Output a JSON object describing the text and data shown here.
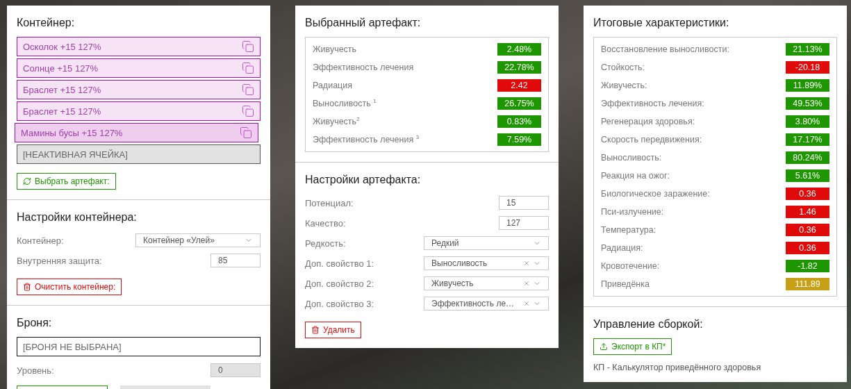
{
  "container": {
    "title": "Контейнер:",
    "slots": [
      {
        "kind": "artifact",
        "label": "Осколок +15 127%",
        "selected": false
      },
      {
        "kind": "artifact",
        "label": "Солнце +15 127%",
        "selected": false
      },
      {
        "kind": "artifact",
        "label": "Браслет +15 127%",
        "selected": false
      },
      {
        "kind": "artifact",
        "label": "Браслет +15 127%",
        "selected": false
      },
      {
        "kind": "artifact",
        "label": "Мамины бусы +15 127%",
        "selected": true
      },
      {
        "kind": "inactive",
        "label": "[НЕАКТИВНАЯ ЯЧЕЙКА]"
      }
    ],
    "button": "Выбрать артефакт:"
  },
  "container_settings": {
    "title": "Настройки контейнера:",
    "container_label": "Контейнер:",
    "container_value": "Контейнер «Улей»",
    "protection_label": "Внутренняя защита:",
    "protection_value": "85",
    "button": "Очистить контейнер:"
  },
  "armor": {
    "title": "Броня:",
    "value": "[БРОНЯ НЕ ВЫБРАНА]",
    "level_label": "Уровень:",
    "level_value": "0"
  },
  "selected_artifact": {
    "title": "Выбранный артефакт:",
    "stats": [
      {
        "label": "Живучесть",
        "value": "2.48%",
        "color": "#1e9600"
      },
      {
        "label": "Эффективность лечения",
        "value": "22.78%",
        "color": "#1e9600"
      },
      {
        "label": "Радиация",
        "value": "2.42",
        "color": "#e00a0a"
      },
      {
        "label": "Выносливость $^{1}$",
        "value": "26.75%",
        "color": "#1e9600"
      },
      {
        "label": "Живучесть$^{2}$",
        "value": "0.83%",
        "color": "#1e9600"
      },
      {
        "label": "Эффективность лечения $^{3}$",
        "value": "7.59%",
        "color": "#1e9600"
      }
    ]
  },
  "artifact_settings": {
    "title": "Настройки артефакта:",
    "fields": [
      {
        "kind": "input",
        "label": "Потенциал:",
        "value": "15"
      },
      {
        "kind": "input",
        "label": "Качество:",
        "value": "127"
      },
      {
        "kind": "select",
        "label": "Редкость:",
        "value": "Редкий",
        "clearable": false
      },
      {
        "kind": "select",
        "label": "Доп. свойство 1:",
        "value": "Выносливость",
        "clearable": true
      },
      {
        "kind": "select",
        "label": "Доп. свойство 2:",
        "value": "Живучесть",
        "clearable": true
      },
      {
        "kind": "select",
        "label": "Доп. свойство 3:",
        "value": "Эффективность ле…",
        "clearable": true
      }
    ],
    "button": "Удалить"
  },
  "totals": {
    "title": "Итоговые характеристики:",
    "stats": [
      {
        "label": "Восстановление выносливости:",
        "value": "21.13%",
        "color": "#1e9600"
      },
      {
        "label": "Стойкость:",
        "value": "-20.18",
        "color": "#e00a0a"
      },
      {
        "label": "Живучесть:",
        "value": "11.89%",
        "color": "#1e9600"
      },
      {
        "label": "Эффективность лечения:",
        "value": "49.53%",
        "color": "#1e9600"
      },
      {
        "label": "Регенерация здоровья:",
        "value": "3.80%",
        "color": "#1e9600"
      },
      {
        "label": "Скорость передвижения:",
        "value": "17.17%",
        "color": "#1e9600"
      },
      {
        "label": "Выносливость:",
        "value": "80.24%",
        "color": "#1e9600"
      },
      {
        "label": "Реакция на ожог:",
        "value": "5.61%",
        "color": "#1e9600"
      },
      {
        "label": "Биологическое заражение:",
        "value": "0.36",
        "color": "#e00a0a"
      },
      {
        "label": "Пси-излучение:",
        "value": "1.46",
        "color": "#e00a0a"
      },
      {
        "label": "Температура:",
        "value": "0.36",
        "color": "#e00a0a"
      },
      {
        "label": "Радиация:",
        "value": "0.36",
        "color": "#e00a0a"
      },
      {
        "label": "Кровотечение:",
        "value": "-1.82",
        "color": "#1e9600"
      },
      {
        "label": "Приведёнка",
        "value": "111.89",
        "color": "#c8a018"
      }
    ]
  },
  "build": {
    "title": "Управление сборкой:",
    "button": "Экспорт в КП*",
    "note": "КП - Калькулятор приведённого здоровья"
  }
}
